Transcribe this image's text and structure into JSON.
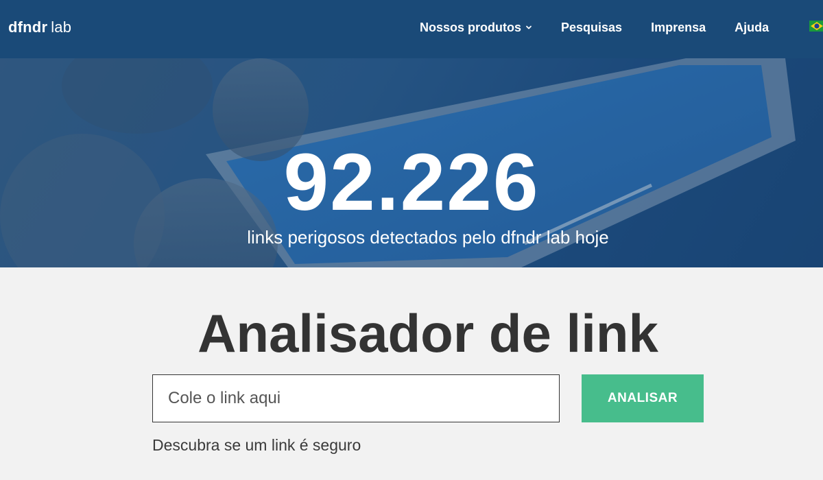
{
  "header": {
    "brand_bold": "dfndr",
    "brand_light": "lab",
    "nav": [
      {
        "label": "Nossos produtos",
        "has_dropdown": true
      },
      {
        "label": "Pesquisas"
      },
      {
        "label": "Imprensa"
      },
      {
        "label": "Ajuda"
      }
    ],
    "language_flag": "brazil-flag-icon"
  },
  "hero": {
    "count": "92.226",
    "subtitle": "links perigosos detectados pelo dfndr lab hoje"
  },
  "analyzer": {
    "title": "Analisador de link",
    "input_placeholder": "Cole o link aqui",
    "button_label": "ANALISAR",
    "helper_text": "Descubra se um link é seguro"
  },
  "colors": {
    "header_bg": "#1a4a78",
    "button_bg": "#47bd8c",
    "page_bg": "#f2f2f2",
    "title_text": "#333333"
  }
}
